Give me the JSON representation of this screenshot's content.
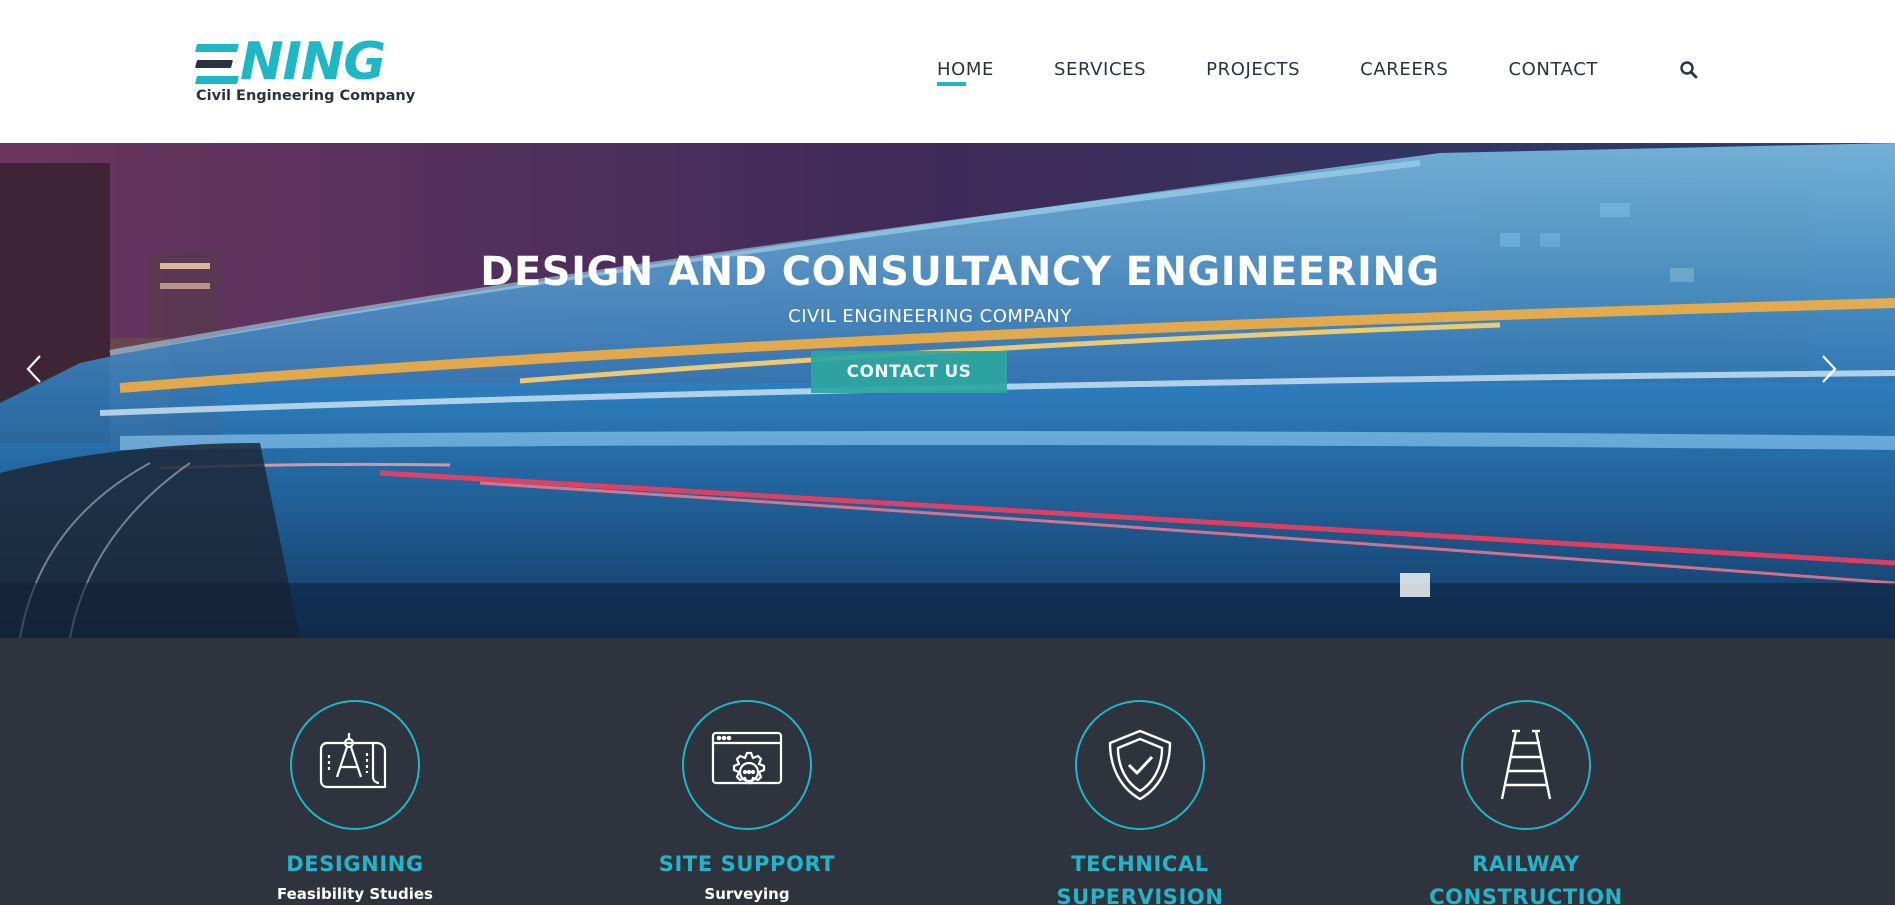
{
  "logo": {
    "word": "NING",
    "subtitle": "Civil Engineering Company"
  },
  "nav": {
    "items": [
      "HOME",
      "SERVICES",
      "PROJECTS",
      "CAREERS",
      "CONTACT"
    ],
    "active": "HOME",
    "search_icon": "search-icon"
  },
  "hero": {
    "title": "DESIGN AND CONSULTANCY ENGINEERING",
    "subtitle": "CIVIL ENGINEERING COMPANY",
    "button": "CONTACT US",
    "prev_icon": "chevron-left-icon",
    "next_icon": "chevron-right-icon"
  },
  "services": [
    {
      "title": "DESIGNING",
      "desc": "Feasibility Studies",
      "icon": "blueprint-icon"
    },
    {
      "title": "SITE SUPPORT",
      "desc": "Surveying",
      "icon": "gear-window-icon"
    },
    {
      "title": "TECHNICAL SUPERVISION",
      "desc": "",
      "icon": "shield-check-icon"
    },
    {
      "title": "RAILWAY CONSTRUCTION",
      "desc": "",
      "icon": "railway-track-icon"
    }
  ],
  "colors": {
    "accent": "#1fb7c6",
    "dark": "#2e333d",
    "button": "#2ca6a0"
  }
}
